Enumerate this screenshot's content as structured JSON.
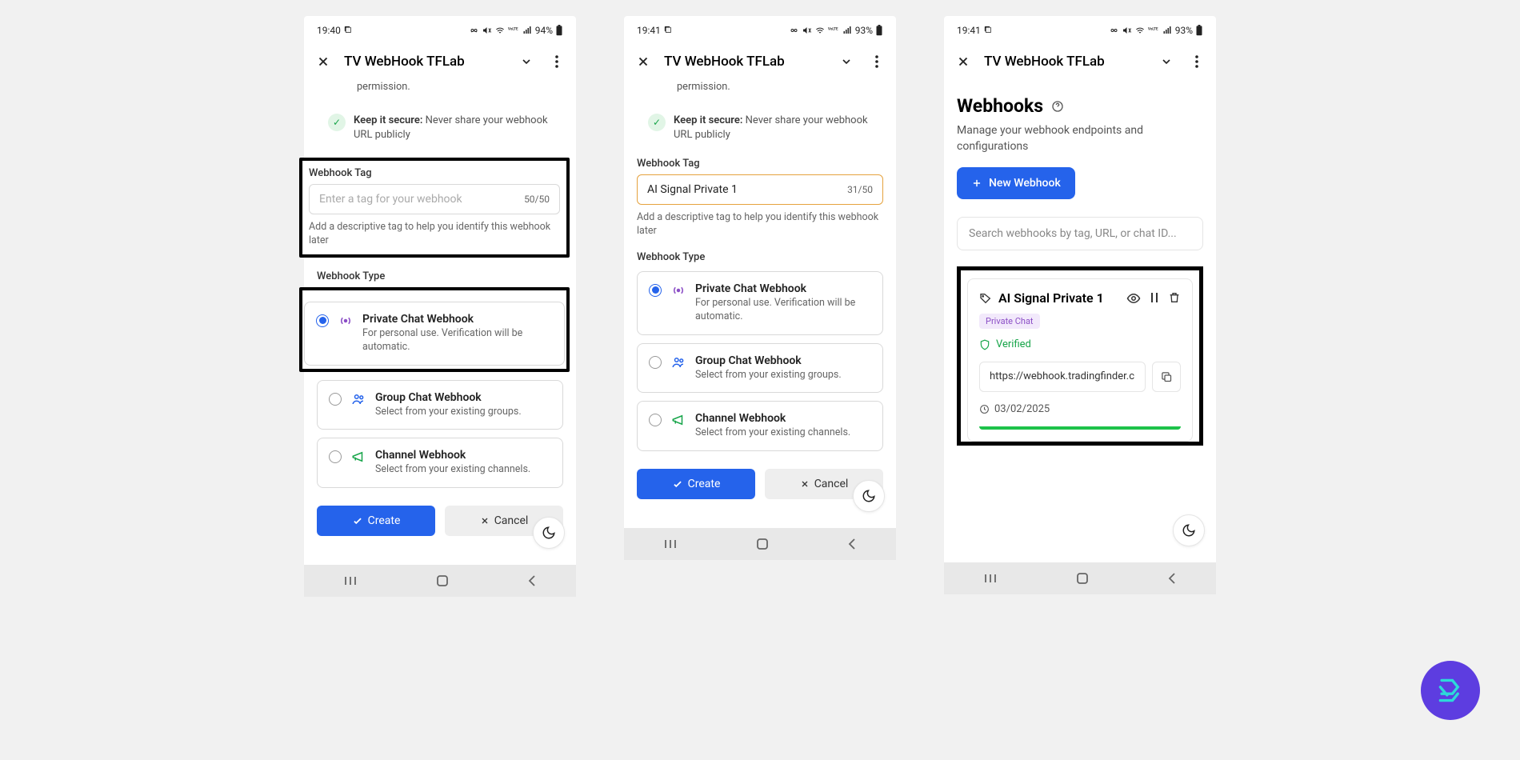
{
  "screen1": {
    "num": "1",
    "statusTime": "19:40",
    "statusBatt": "94%",
    "title": "TV WebHook TFLab",
    "tipBold": "Keep it secure:",
    "tipRest": " Never share your webhook URL publicly",
    "tagLabel": "Webhook Tag",
    "tagPlaceholder": "Enter a tag for your webhook",
    "tagCount": "50/50",
    "tagHelp": "Add a descriptive tag to help you identify this webhook later",
    "typeLabel": "Webhook Type",
    "opt1Title": "Private Chat Webhook",
    "opt1Sub": "For personal use. Verification will be automatic.",
    "opt2Title": "Group Chat Webhook",
    "opt2Sub": "Select from your existing groups.",
    "opt3Title": "Channel Webhook",
    "opt3Sub": "Select from your existing channels.",
    "create": "Create",
    "cancel": "Cancel"
  },
  "screen2": {
    "num": "2",
    "statusTime": "19:41",
    "statusBatt": "93%",
    "title": "TV WebHook TFLab",
    "tipBold": "Keep it secure:",
    "tipRest": " Never share your webhook URL publicly",
    "tagLabel": "Webhook Tag",
    "tagValue": "AI Signal Private 1",
    "tagCount": "31/50",
    "tagHelp": "Add a descriptive tag to help you identify this webhook later",
    "typeLabel": "Webhook Type",
    "opt1Title": "Private Chat Webhook",
    "opt1Sub": "For personal use. Verification will be automatic.",
    "opt2Title": "Group Chat Webhook",
    "opt2Sub": "Select from your existing groups.",
    "opt3Title": "Channel Webhook",
    "opt3Sub": "Select from your existing channels.",
    "create": "Create",
    "cancel": "Cancel"
  },
  "screen3": {
    "num": "3",
    "statusTime": "19:41",
    "statusBatt": "93%",
    "title": "TV WebHook TFLab",
    "h1": "Webhooks",
    "sub": "Manage your webhook endpoints and configurations",
    "newBtn": "New Webhook",
    "search": "Search webhooks by tag, URL, or chat ID...",
    "cardTitle": "AI Signal Private 1",
    "badge": "Private Chat",
    "verified": "Verified",
    "url": "https://webhook.tradingfinder.c",
    "date": "03/02/2025"
  }
}
